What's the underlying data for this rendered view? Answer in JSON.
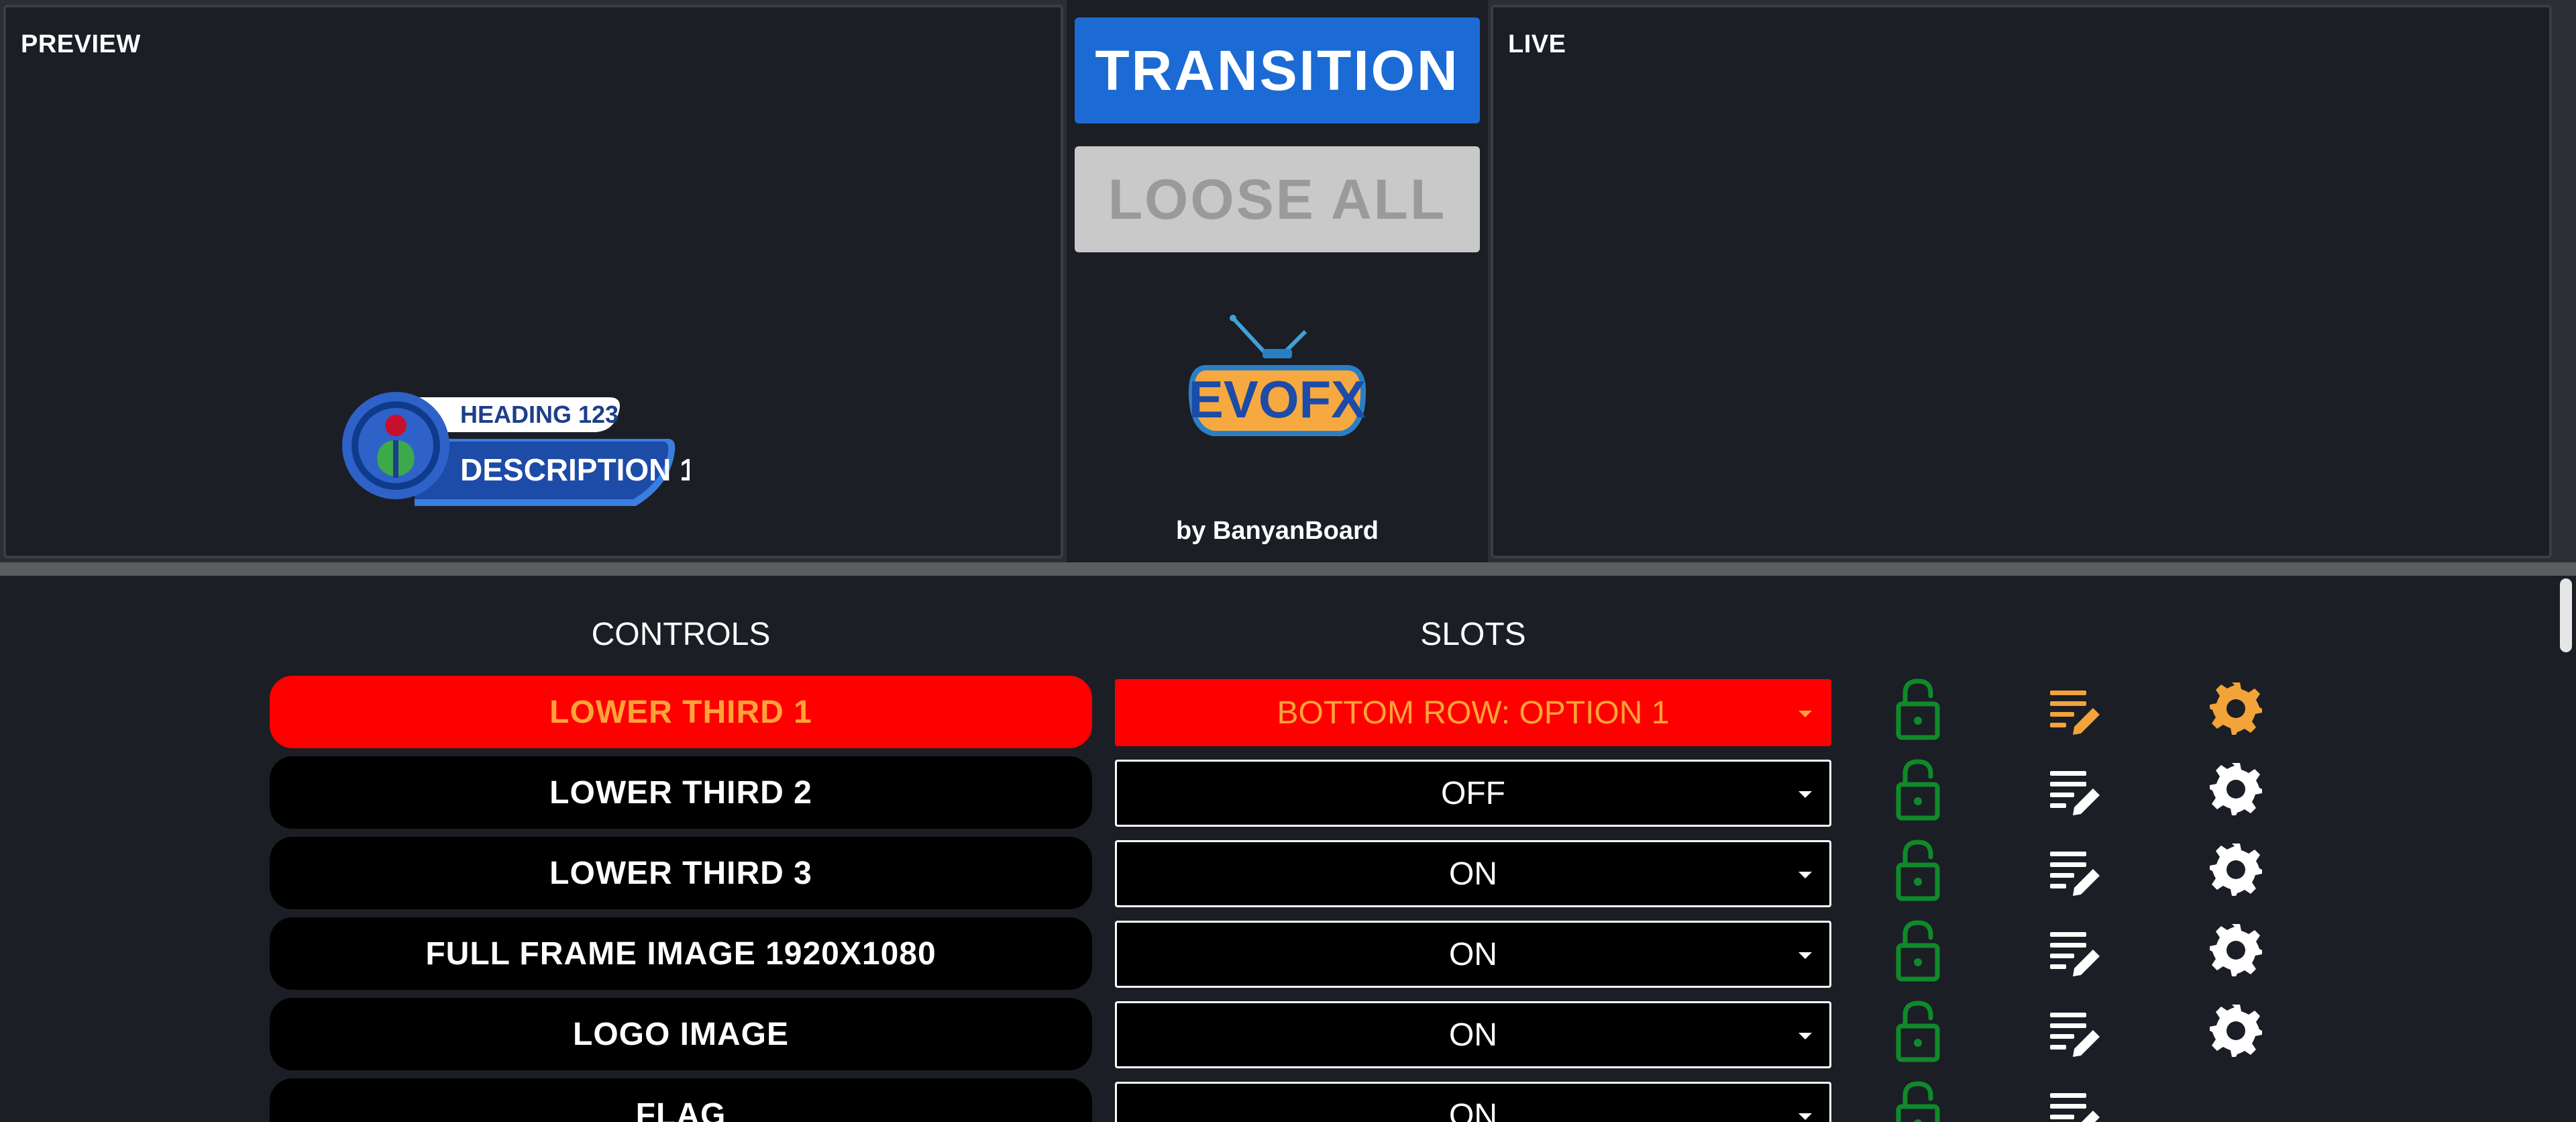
{
  "preview": {
    "label": "PREVIEW",
    "graphic": {
      "heading": "HEADING 123",
      "description": "DESCRIPTION 1"
    }
  },
  "live": {
    "label": "LIVE"
  },
  "center": {
    "transition_label": "TRANSITION",
    "loose_all_label": "LOOSE ALL",
    "logo_text": "EVOFX",
    "byline": "by BanyanBoard"
  },
  "table": {
    "controls_header": "CONTROLS",
    "slots_header": "SLOTS",
    "rows": [
      {
        "control": "LOWER THIRD 1",
        "slot": "BOTTOM ROW: OPTION 1",
        "active": true
      },
      {
        "control": "LOWER THIRD 2",
        "slot": "OFF",
        "active": false
      },
      {
        "control": "LOWER THIRD 3",
        "slot": "ON",
        "active": false
      },
      {
        "control": "FULL FRAME IMAGE 1920X1080",
        "slot": "ON",
        "active": false
      },
      {
        "control": "LOGO IMAGE",
        "slot": "ON",
        "active": false
      },
      {
        "control": "FLAG",
        "slot": "ON",
        "active": false
      }
    ]
  },
  "icons": {
    "lock": "unlocked-lock-icon",
    "edit": "edit-text-icon",
    "settings": "gear-icon"
  },
  "colors": {
    "active_bg": "#ff0000",
    "active_text": "#ffa33a",
    "lock_green": "#0f8a2a",
    "transition_blue": "#1c6bd4",
    "edit_active": "#f2a33a"
  }
}
